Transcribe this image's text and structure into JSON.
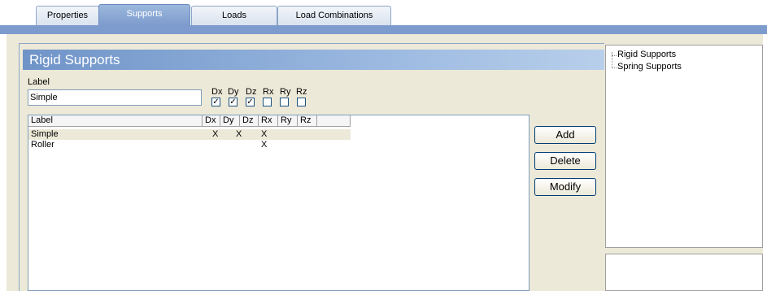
{
  "tabs": [
    {
      "label": "Properties",
      "active": false
    },
    {
      "label": "Supports",
      "active": true
    },
    {
      "label": "Loads",
      "active": false
    },
    {
      "label": "Load Combinations",
      "active": false
    }
  ],
  "panel": {
    "title": "Rigid Supports",
    "label_caption": "Label",
    "label_value": "Simple",
    "dof_labels": [
      "Dx",
      "Dy",
      "Dz",
      "Rx",
      "Ry",
      "Rz"
    ],
    "dof_checked": [
      "✓",
      "✓",
      "✓",
      "",
      "",
      ""
    ]
  },
  "table": {
    "columns": [
      "Label",
      "Dx",
      "Dy",
      "Dz",
      "Rx",
      "Ry",
      "Rz"
    ],
    "rows": [
      {
        "label": "Simple",
        "dx": "X",
        "dy": "X",
        "dz": "X",
        "rx": "",
        "ry": "",
        "rz": ""
      },
      {
        "label": "Roller",
        "dx": "",
        "dy": "",
        "dz": "X",
        "rx": "",
        "ry": "",
        "rz": ""
      }
    ]
  },
  "buttons": {
    "add": "Add",
    "delete": "Delete",
    "modify": "Modify"
  },
  "tree": {
    "items": [
      "Rigid Supports",
      "Spring Supports"
    ]
  }
}
